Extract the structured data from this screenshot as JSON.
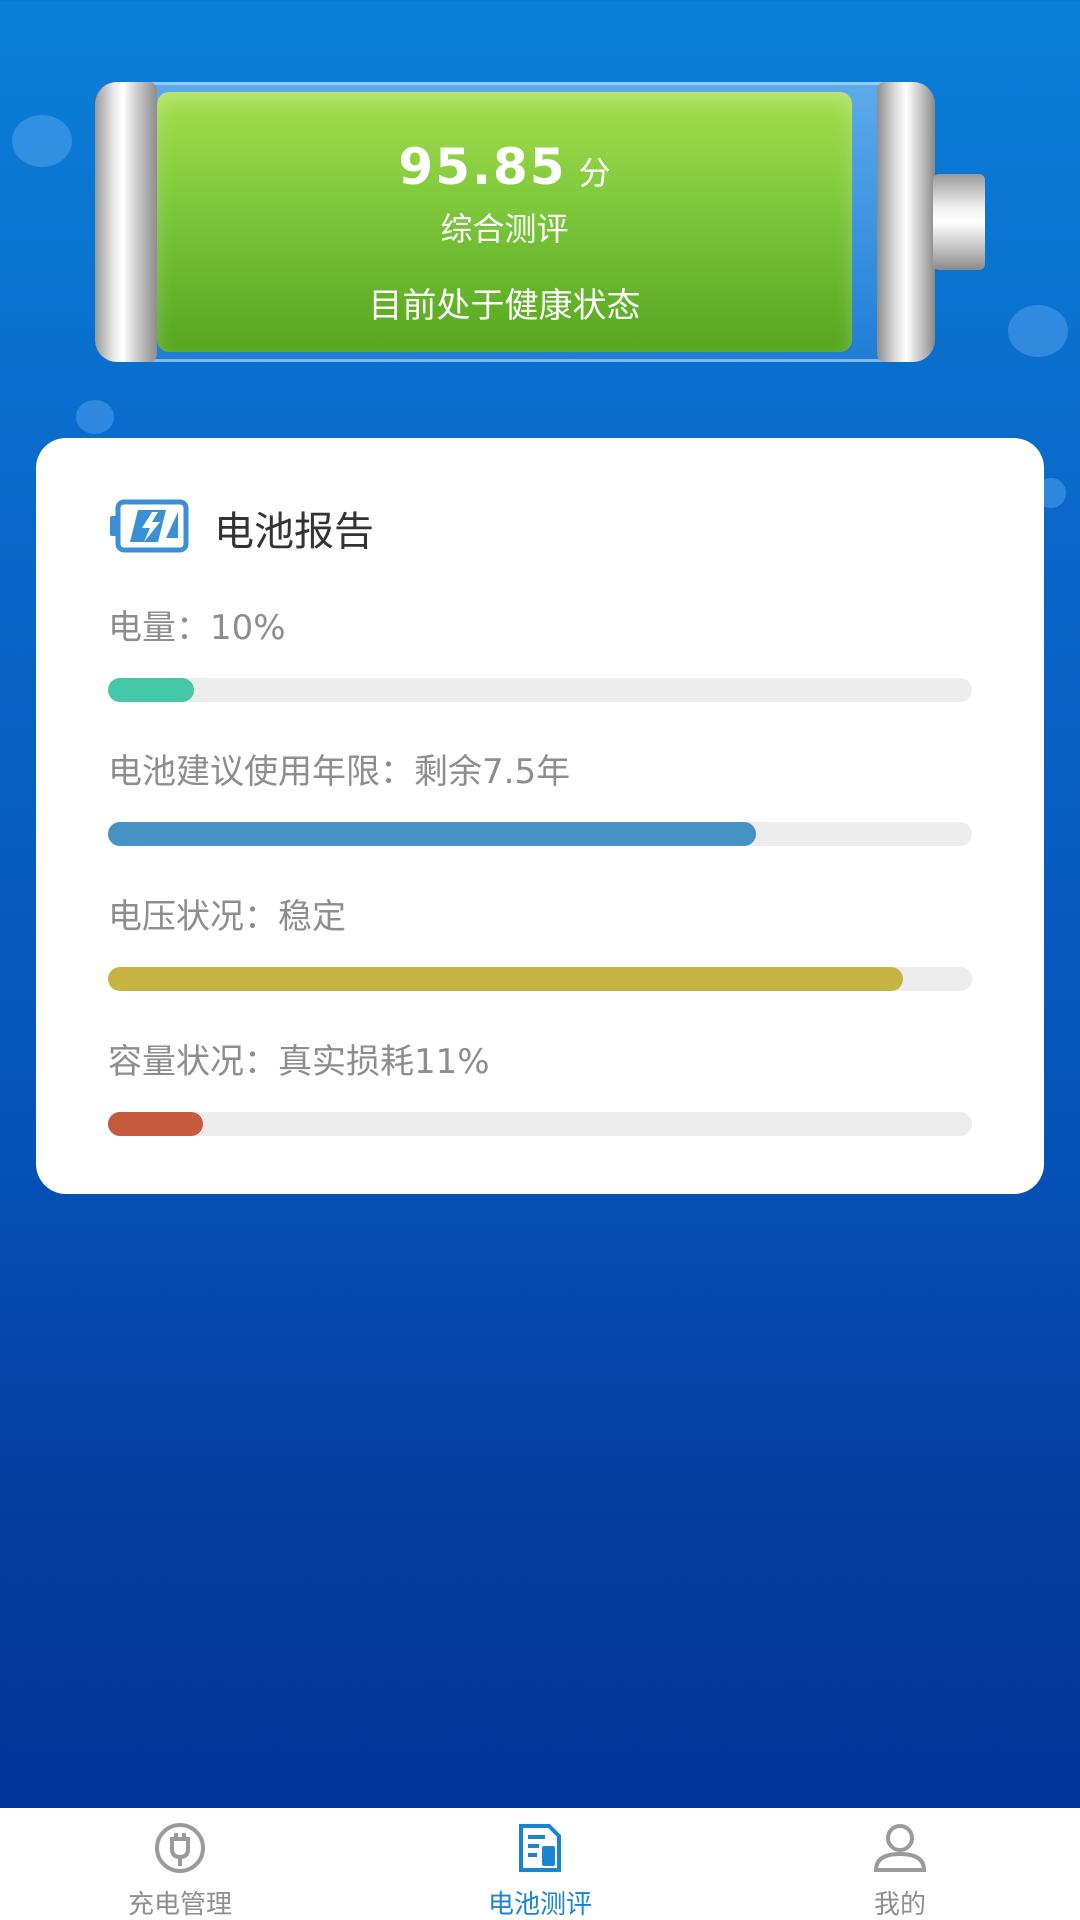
{
  "battery": {
    "score": "95.85",
    "score_unit": "分",
    "score_label": "综合测评",
    "status": "目前处于健康状态"
  },
  "report": {
    "icon": "battery-charge-icon",
    "title": "电池报告",
    "metrics": [
      {
        "label": "电量：10%",
        "fraction": 0.1,
        "color": "#45c8a8"
      },
      {
        "label": "电池建议使用年限：剩余7.5年",
        "fraction": 0.75,
        "color": "#4592c4"
      },
      {
        "label": "电压状况：稳定",
        "fraction": 0.92,
        "color": "#c6b442"
      },
      {
        "label": "容量状况：真实损耗11%",
        "fraction": 0.11,
        "color": "#c55a3e"
      }
    ]
  },
  "nav": {
    "items": [
      {
        "label": "充电管理",
        "icon": "plug-icon",
        "active": false
      },
      {
        "label": "电池测评",
        "icon": "report-icon",
        "active": true
      },
      {
        "label": "我的",
        "icon": "user-icon",
        "active": false
      }
    ],
    "active_color": "#1a84d0",
    "inactive_color": "#8e8e8e"
  }
}
